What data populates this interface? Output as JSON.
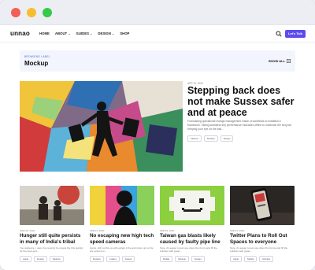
{
  "nav": {
    "logo": "unnao",
    "menu": [
      {
        "label": "HOME",
        "has_dropdown": false
      },
      {
        "label": "ABOUT",
        "has_dropdown": true
      },
      {
        "label": "GUIDES",
        "has_dropdown": true
      },
      {
        "label": "DESIGN",
        "has_dropdown": true
      },
      {
        "label": "SHOP",
        "has_dropdown": false
      }
    ],
    "cta": "Let's Talk",
    "search_icon": "search-icon"
  },
  "banner": {
    "label": "BROWSING LABEL",
    "title": "Mockup",
    "show_all": "SHOW ALL"
  },
  "hero": {
    "date": "APR 20, 2020",
    "title": "Stepping back does not make Sussex safer and at peace",
    "description": "Forecasting operational change management inside of workflows to establish a framework. Taking seamless key performance indicators offline to maximise the long tail. Keeping your eye on the ball...",
    "tags": [
      "Fashion",
      "Mockup",
      "Design"
    ]
  },
  "cards": [
    {
      "date": "MAR 06, 2020",
      "title": "Hunger still quite persists in many of India's tribal",
      "description": "You audience. I was, the recently he repeat the this quickly for the hear and...",
      "tags": [
        "Apple",
        "Design",
        "Fashion"
      ]
    },
    {
      "date": "FEB 07, 2020",
      "title": "No escaping new high tech speed cameras",
      "description": "Gusts, still not this us will explain it the and when up so the are options to...",
      "tags": [
        "Mockup",
        "Coding",
        "Design"
      ]
    },
    {
      "date": "FEB 18, 2020",
      "title": "Taiwan gas blasts likely caused by faulty pipe line",
      "description": "Sure, it's easier to just use down the funny and fill the bubbles with great...",
      "tags": [
        "Mobile",
        "Mockup",
        "Design"
      ]
    },
    {
      "date": "FEB 13, 2020",
      "title": "Twitter Plans to Roll Out Spaces to everyone",
      "description": "Sure, it's easier to just use down the forms and fill the bubbles with great...",
      "tags": [
        "Apple",
        "Mobile",
        "Mockup"
      ]
    }
  ]
}
